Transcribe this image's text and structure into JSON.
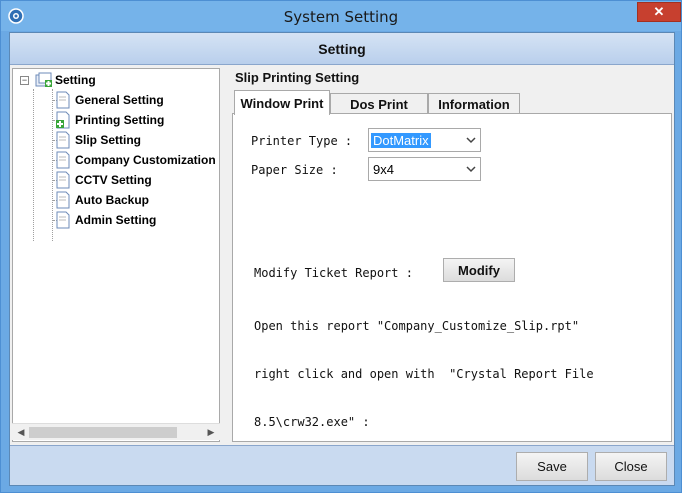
{
  "window": {
    "title": "System Setting",
    "close_symbol": "✕",
    "app_icon": "gear-icon"
  },
  "header": {
    "title": "Setting"
  },
  "tree": {
    "root": {
      "label": "Setting",
      "expander": "−",
      "icon": "folder-icon"
    },
    "items": [
      {
        "label": "General Setting",
        "icon": "document-icon"
      },
      {
        "label": "Printing Setting",
        "icon": "document-add-icon"
      },
      {
        "label": "Slip Setting",
        "icon": "document-icon"
      },
      {
        "label": "Company Customization",
        "icon": "document-icon"
      },
      {
        "label": "CCTV Setting",
        "icon": "document-icon"
      },
      {
        "label": "Auto Backup",
        "icon": "document-icon"
      },
      {
        "label": "Admin Setting",
        "icon": "document-icon"
      }
    ],
    "scroll_left": "◀",
    "scroll_right": "▶"
  },
  "content": {
    "section_title": "Slip Printing Setting",
    "tabs": [
      {
        "label": "Window Print",
        "active": true
      },
      {
        "label": "Dos Print",
        "active": false
      },
      {
        "label": "Information",
        "active": false
      }
    ],
    "printer_type": {
      "label": "Printer Type :",
      "value": "DotMatrix"
    },
    "paper_size": {
      "label": "Paper Size  :",
      "value": "9x4"
    },
    "modify": {
      "label": "Modify Ticket Report :",
      "button": "Modify"
    },
    "note_lines": [
      "Open this report \"Company_Customize_Slip.rpt\"",
      "right click and open with  \"Crystal Report File",
      "8.5\\crw32.exe\" :"
    ]
  },
  "footer": {
    "save": "Save",
    "close": "Close"
  },
  "colors": {
    "titlebar": "#75b3ea",
    "close_button": "#c7402f",
    "selection": "#3399ff"
  }
}
